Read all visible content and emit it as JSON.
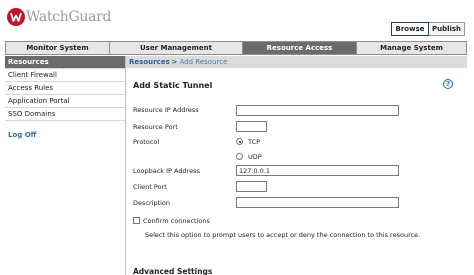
{
  "logo": {
    "text": "WatchGuard"
  },
  "top_buttons": {
    "browse": "Browse",
    "publish": "Publish"
  },
  "nav_tabs": [
    "Monitor System",
    "User Management",
    "Resource Access",
    "Manage System"
  ],
  "active_nav_tab": "Resource Access",
  "sidebar": {
    "items": [
      "Resources",
      "Client Firewall",
      "Access Rules",
      "Application Portal",
      "SSO Domains"
    ],
    "active": "Resources",
    "logoff": "Log Off"
  },
  "breadcrumb": {
    "link": "Resources",
    "separator": ">",
    "current": "Add Resource"
  },
  "help_icon": "?",
  "form": {
    "title": "Add Static Tunnel",
    "resource_ip_label": "Resource IP Address",
    "resource_ip_value": "",
    "resource_port_label": "Resource Port",
    "resource_port_value": "",
    "protocol_label": "Protocol",
    "protocol_tcp": "TCP",
    "protocol_udp": "UDP",
    "protocol_selected": "TCP",
    "loopback_ip_label": "Loopback IP Address",
    "loopback_ip_value": "127.0.0.1",
    "client_port_label": "Client Port",
    "client_port_value": "",
    "description_label": "Description",
    "description_value": "",
    "confirm_label": "Confirm connections",
    "confirm_checked": false,
    "confirm_note": "Select this option to prompt users to accept or deny the connection to this resource.",
    "advanced_title": "Advanced Settings"
  },
  "colors": {
    "logo_red": "#c8102e",
    "active_tab": "#6b6b6b",
    "link_blue": "#2a5f97"
  }
}
